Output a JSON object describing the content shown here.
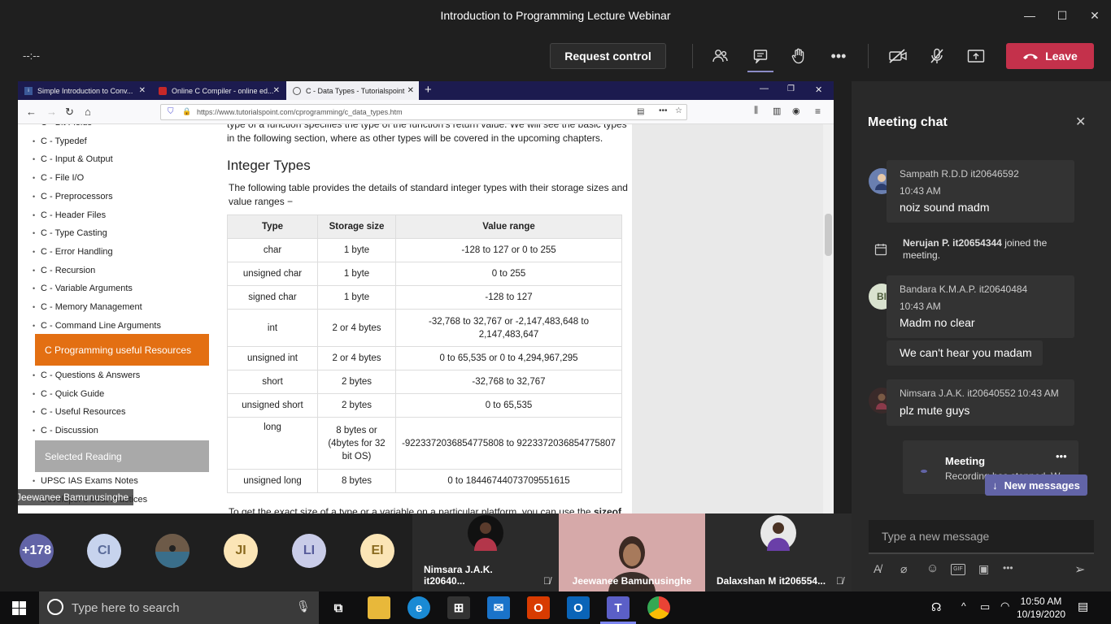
{
  "window": {
    "title": "Introduction to Programming Lecture Webinar",
    "minimize": "—",
    "maximize": "☐",
    "close": "✕"
  },
  "toolbar": {
    "timer": "--:--",
    "request_control": "Request control",
    "more": "•••",
    "leave": "Leave"
  },
  "browser": {
    "tabs": [
      {
        "label": "Simple Introduction to Conv...",
        "icon": "site-icon"
      },
      {
        "label": "Online C Compiler - online ed...",
        "icon": "compiler-icon"
      },
      {
        "label": "C - Data Types - Tutorialspoint",
        "icon": "tutorialspoint-icon"
      }
    ],
    "url": "https://www.tutorialspoint.com/cprogramming/c_data_types.htm"
  },
  "sidebar": {
    "items_top": [
      "C - Bit Fields",
      "C - Typedef",
      "C - Input & Output",
      "C - File I/O",
      "C - Preprocessors",
      "C - Header Files",
      "C - Type Casting",
      "C - Error Handling",
      "C - Recursion",
      "C - Variable Arguments",
      "C - Memory Management",
      "C - Command Line Arguments"
    ],
    "resources_heading": "C Programming useful Resources",
    "items_resources": [
      "C - Questions & Answers",
      "C - Quick Guide",
      "C - Useful Resources",
      "C - Discussion"
    ],
    "reading_heading": "Selected Reading",
    "items_reading": [
      "UPSC IAS Exams Notes",
      "Developer's Best Practices"
    ]
  },
  "content": {
    "intro_line1": "type of a function specifies the type of the function's return value. We will see the basic types",
    "intro_line2": "in the following section, where as other types will be covered in the upcoming chapters.",
    "heading": "Integer Types",
    "desc_line1": "The following table provides the details of standard integer types with their storage sizes and",
    "desc_line2": "value ranges −",
    "table": {
      "headers": [
        "Type",
        "Storage size",
        "Value range"
      ],
      "rows": [
        [
          "char",
          "1 byte",
          "-128 to 127 or 0 to 255"
        ],
        [
          "unsigned char",
          "1 byte",
          "0 to 255"
        ],
        [
          "signed char",
          "1 byte",
          "-128 to 127"
        ],
        [
          "int",
          "2 or 4 bytes",
          "-32,768 to 32,767 or -2,147,483,648 to 2,147,483,647"
        ],
        [
          "unsigned int",
          "2 or 4 bytes",
          "0 to 65,535 or 0 to 4,294,967,295"
        ],
        [
          "short",
          "2 bytes",
          "-32,768 to 32,767"
        ],
        [
          "unsigned short",
          "2 bytes",
          "0 to 65,535"
        ],
        [
          "long",
          "8 bytes or (4bytes for 32 bit OS)",
          "-9223372036854775808 to 9223372036854775807"
        ],
        [
          "unsigned long",
          "8 bytes",
          "0 to 18446744073709551615"
        ]
      ]
    },
    "footer_text": "To get the exact size of a type or a variable on a particular platform, you can use the",
    "footer_bold": "sizeof"
  },
  "presenter_label": "Jeewanee Bamunusinghe",
  "chat": {
    "title": "Meeting chat",
    "messages": [
      {
        "author": "Sampath R.D.D it20646592",
        "time": "10:43 AM",
        "text": "noiz sound madm"
      },
      {
        "author": "Bandara K.M.A.P. it20640484",
        "initials": "BI",
        "time": "10:43 AM",
        "text": "Madm no clear",
        "followup": "We can't hear you madam"
      },
      {
        "author": "Nimsara J.A.K. it20640552",
        "time": "10:43 AM",
        "text": "plz mute guys"
      }
    ],
    "event": {
      "name": "Nerujan P. it20654344",
      "action": "joined the meeting."
    },
    "meeting_card": {
      "title": "Meeting",
      "subtitle": "Recording has stopped. W..."
    },
    "new_messages": "New messages",
    "compose_placeholder": "Type a new message"
  },
  "participants": {
    "overflow": "+178",
    "circles": [
      {
        "initials": "CI",
        "color": "#c7d3ed",
        "text_color": "#5b6c9a"
      },
      {
        "initials": "JI",
        "color": "#fbe5b6",
        "text_color": "#8a6a1f"
      },
      {
        "initials": "LI",
        "color": "#c9cce8",
        "text_color": "#565b9a"
      },
      {
        "initials": "EI",
        "color": "#fbe5b6",
        "text_color": "#8a6a1f"
      }
    ],
    "tiles": [
      "Nimsara J.A.K. it20640...",
      "Jeewanee Bamunusinghe",
      "Dalaxshan M it206554..."
    ]
  },
  "taskbar": {
    "search_placeholder": "Type here to search",
    "time": "10:50 AM",
    "date": "10/19/2020"
  },
  "colors": {
    "leave": "#c4314b",
    "resources_heading": "#e36f12",
    "reading_heading": "#a9a9a9",
    "overflow_circle": "#6264a7"
  }
}
